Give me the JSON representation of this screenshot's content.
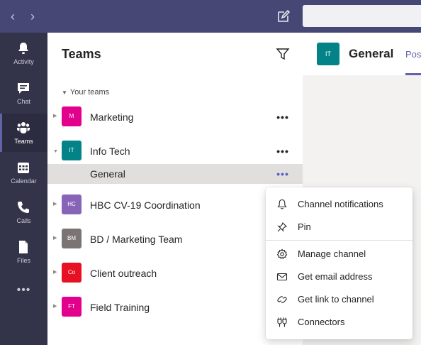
{
  "rail": {
    "activity": "Activity",
    "chat": "Chat",
    "teams": "Teams",
    "calendar": "Calendar",
    "calls": "Calls",
    "files": "Files",
    "more": "•••"
  },
  "pane": {
    "title": "Teams",
    "section_label": "Your teams"
  },
  "teams": [
    {
      "name": "Marketing",
      "initials": "M",
      "color": "#e3008c"
    },
    {
      "name": "Info Tech",
      "initials": "IT",
      "color": "#038387"
    },
    {
      "name": "HBC CV-19 Coordination",
      "initials": "HC",
      "color": "#8764b8"
    },
    {
      "name": "BD / Marketing Team",
      "initials": "BM",
      "color": "#7a7574"
    },
    {
      "name": "Client outreach",
      "initials": "Co",
      "color": "#e81123"
    },
    {
      "name": "Field Training",
      "initials": "FT",
      "color": "#e3008c"
    }
  ],
  "channel": {
    "name": "General"
  },
  "dots": "•••",
  "header": {
    "initials": "IT",
    "title": "General",
    "tab": "Pos"
  },
  "menu": {
    "items": [
      "Channel notifications",
      "Pin",
      "Manage channel",
      "Get email address",
      "Get link to channel",
      "Connectors"
    ]
  },
  "colors": {
    "titlebar": "#464775",
    "rail": "#33344a",
    "accent": "#6264a7"
  }
}
